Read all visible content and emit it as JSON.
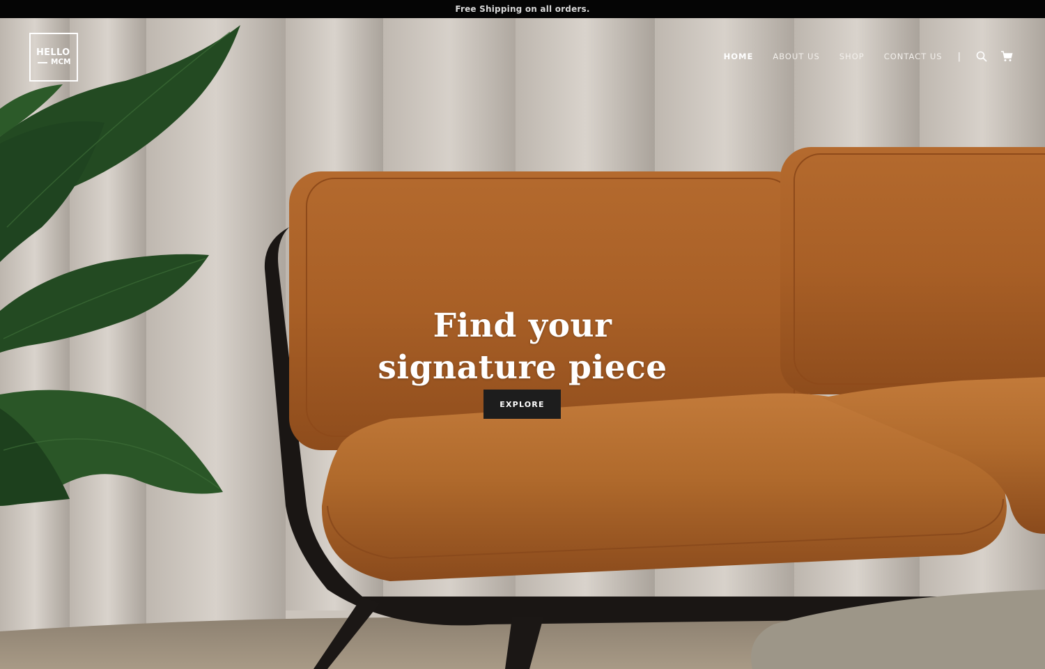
{
  "announcement": {
    "text": "Free Shipping on all orders."
  },
  "logo": {
    "line1": "HELLO",
    "line2": "MCM"
  },
  "nav": {
    "items": [
      {
        "label": "HOME",
        "active": true
      },
      {
        "label": "ABOUT US",
        "active": false
      },
      {
        "label": "SHOP",
        "active": false
      },
      {
        "label": "CONTACT US",
        "active": false
      }
    ],
    "separator": "|",
    "icons": [
      "search-icon",
      "cart-icon"
    ]
  },
  "hero": {
    "headline_line1": "Find your",
    "headline_line2": "signature piece",
    "cta_label": "EXPLORE"
  },
  "colors": {
    "announcement_bg": "#050505",
    "cta_bg": "#1d1d1d",
    "leather": "#a85f26",
    "curtain": "#cfc8c0"
  }
}
